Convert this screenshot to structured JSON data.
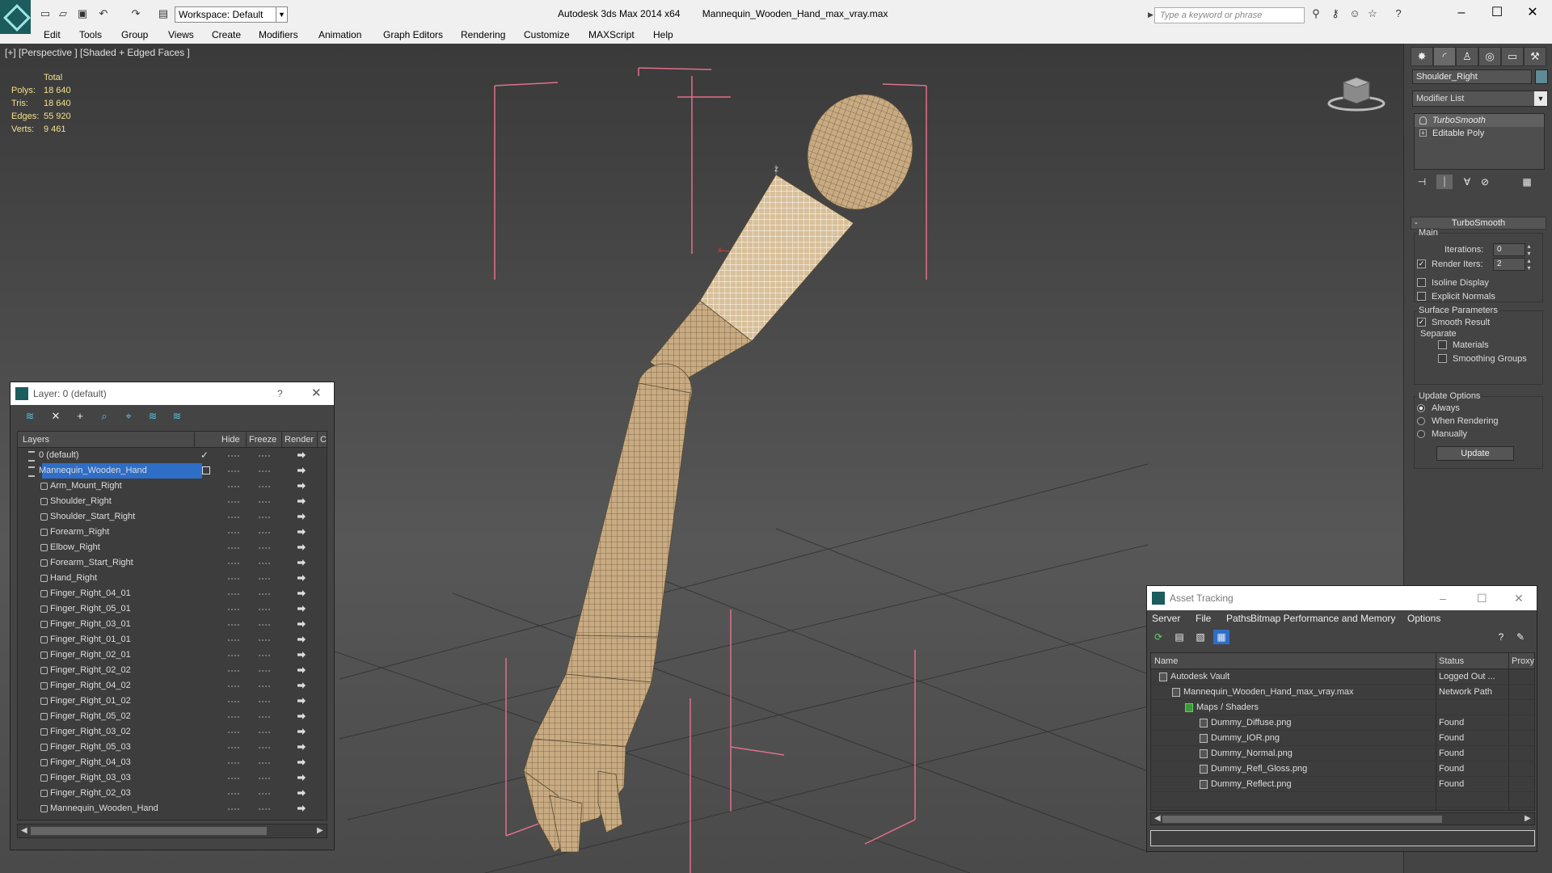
{
  "titlebar": {
    "workspace": "Workspace: Default",
    "app_name": "Autodesk 3ds Max  2014 x64",
    "file_name": "Mannequin_Wooden_Hand_max_vray.max",
    "search_placeholder": "Type a keyword or phrase"
  },
  "menu": [
    "Edit",
    "Tools",
    "Group",
    "Views",
    "Create",
    "Modifiers",
    "Animation",
    "Graph Editors",
    "Rendering",
    "Customize",
    "MAXScript",
    "Help"
  ],
  "viewport": {
    "label": "[+] [Perspective ] [Shaded + Edged Faces ]",
    "stats_header": "Total",
    "stats": [
      {
        "k": "Polys:",
        "v": "18 640"
      },
      {
        "k": "Tris:",
        "v": "18 640"
      },
      {
        "k": "Edges:",
        "v": "55 920"
      },
      {
        "k": "Verts:",
        "v": "9 461"
      }
    ],
    "axis_z": "z",
    "axis_x": "x"
  },
  "command_panel": {
    "object_name": "Shoulder_Right",
    "modifier_list": "Modifier List",
    "stack": [
      "TurboSmooth",
      "Editable Poly"
    ],
    "rollout_title": "TurboSmooth",
    "main_group": "Main",
    "iterations_label": "Iterations:",
    "iterations_value": "0",
    "render_iters_label": "Render Iters:",
    "render_iters_value": "2",
    "isoline_label": "Isoline Display",
    "explicit_normals_label": "Explicit Normals",
    "surface_group": "Surface Parameters",
    "smooth_result_label": "Smooth Result",
    "separate_label": "Separate",
    "materials_label": "Materials",
    "smoothing_groups_label": "Smoothing Groups",
    "update_group": "Update Options",
    "always_label": "Always",
    "when_rendering_label": "When Rendering",
    "manually_label": "Manually",
    "update_button": "Update"
  },
  "layer_dialog": {
    "title": "Layer: 0 (default)",
    "help": "?",
    "col_layers": "Layers",
    "col_hide": "Hide",
    "col_freeze": "Freeze",
    "col_render": "Render",
    "col_c": "C",
    "rows": [
      {
        "name": "0 (default)",
        "type": "layer"
      },
      {
        "name": "Mannequin_Wooden_Hand",
        "type": "layer"
      },
      {
        "name": "Arm_Mount_Right",
        "type": "obj"
      },
      {
        "name": "Shoulder_Right",
        "type": "obj"
      },
      {
        "name": "Shoulder_Start_Right",
        "type": "obj"
      },
      {
        "name": "Forearm_Right",
        "type": "obj"
      },
      {
        "name": "Elbow_Right",
        "type": "obj"
      },
      {
        "name": "Forearm_Start_Right",
        "type": "obj"
      },
      {
        "name": "Hand_Right",
        "type": "obj"
      },
      {
        "name": "Finger_Right_04_01",
        "type": "obj"
      },
      {
        "name": "Finger_Right_05_01",
        "type": "obj"
      },
      {
        "name": "Finger_Right_03_01",
        "type": "obj"
      },
      {
        "name": "Finger_Right_01_01",
        "type": "obj"
      },
      {
        "name": "Finger_Right_02_01",
        "type": "obj"
      },
      {
        "name": "Finger_Right_02_02",
        "type": "obj"
      },
      {
        "name": "Finger_Right_04_02",
        "type": "obj"
      },
      {
        "name": "Finger_Right_01_02",
        "type": "obj"
      },
      {
        "name": "Finger_Right_05_02",
        "type": "obj"
      },
      {
        "name": "Finger_Right_03_02",
        "type": "obj"
      },
      {
        "name": "Finger_Right_05_03",
        "type": "obj"
      },
      {
        "name": "Finger_Right_04_03",
        "type": "obj"
      },
      {
        "name": "Finger_Right_03_03",
        "type": "obj"
      },
      {
        "name": "Finger_Right_02_03",
        "type": "obj"
      },
      {
        "name": "Mannequin_Wooden_Hand",
        "type": "obj"
      }
    ]
  },
  "asset_dialog": {
    "title": "Asset Tracking",
    "menu": [
      "Server",
      "File",
      "Paths",
      "Bitmap Performance and Memory",
      "Options"
    ],
    "col_name": "Name",
    "col_status": "Status",
    "col_proxy": "Proxy",
    "rows": [
      {
        "name": "Autodesk Vault",
        "status": "Logged Out ..."
      },
      {
        "name": "Mannequin_Wooden_Hand_max_vray.max",
        "status": "Network Path"
      },
      {
        "name": "Maps / Shaders",
        "status": ""
      },
      {
        "name": "Dummy_Diffuse.png",
        "status": "Found"
      },
      {
        "name": "Dummy_IOR.png",
        "status": "Found"
      },
      {
        "name": "Dummy_Normal.png",
        "status": "Found"
      },
      {
        "name": "Dummy_Refl_Gloss.png",
        "status": "Found"
      },
      {
        "name": "Dummy_Reflect.png",
        "status": "Found"
      }
    ]
  },
  "colors": {
    "selection": "#2e6ec7",
    "stats_text": "#f2e08a",
    "bbox": "#e0708a",
    "wood": "#c8ab82"
  }
}
